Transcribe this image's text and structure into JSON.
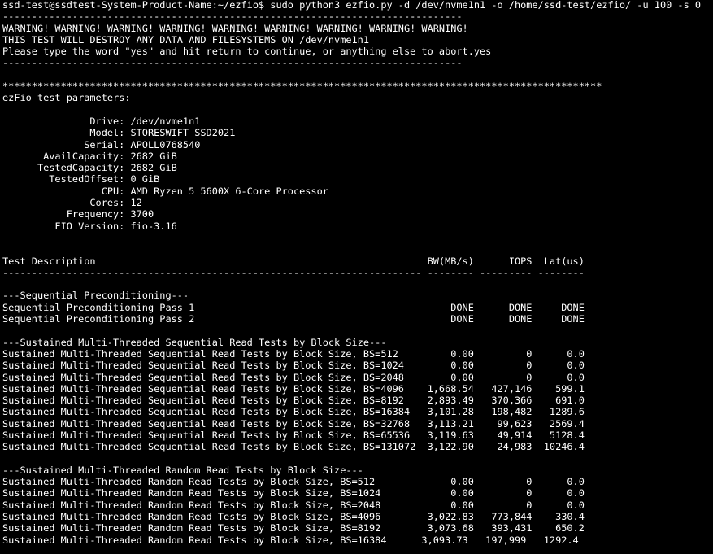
{
  "terminal": {
    "background": "#000000",
    "foreground": "#ffffff",
    "lines": [
      "ssd-test@ssdtest-System-Product-Name:~/ezfio$ sudo python3 ezfio.py -d /dev/nvme1n1 -o /home/ssd-test/ezfio/ -u 100 -s 0",
      "-------------------------------------------------------------------------------",
      "WARNING! WARNING! WARNING! WARNING! WARNING! WARNING! WARNING! WARNING! WARNING!",
      "THIS TEST WILL DESTROY ANY DATA AND FILESYSTEMS ON /dev/nvme1n1",
      "Please type the word \"yes\" and hit return to continue, or anything else to abort.yes",
      "-------------------------------------------------------------------------------",
      "",
      "*******************************************************************************************************",
      "ezFio test parameters:",
      "",
      "               Drive: /dev/nvme1n1",
      "               Model: STORESWIFT SSD2021",
      "              Serial: APOLL0768540",
      "       AvailCapacity: 2682 GiB",
      "      TestedCapacity: 2682 GiB",
      "        TestedOffset: 0 GiB",
      "                 CPU: AMD Ryzen 5 5600X 6-Core Processor",
      "               Cores: 12",
      "           Frequency: 3700",
      "         FIO Version: fio-3.16",
      "",
      "",
      "Test Description                                                         BW(MB/s)      IOPS  Lat(us)",
      "------------------------------------------------------------------------ -------- --------- --------",
      "",
      "---Sequential Preconditioning---",
      "Sequential Preconditioning Pass 1                                            DONE      DONE     DONE",
      "Sequential Preconditioning Pass 2                                            DONE      DONE     DONE",
      "",
      "---Sustained Multi-Threaded Sequential Read Tests by Block Size---",
      "Sustained Multi-Threaded Sequential Read Tests by Block Size, BS=512         0.00         0      0.0",
      "Sustained Multi-Threaded Sequential Read Tests by Block Size, BS=1024        0.00         0      0.0",
      "Sustained Multi-Threaded Sequential Read Tests by Block Size, BS=2048        0.00         0      0.0",
      "Sustained Multi-Threaded Sequential Read Tests by Block Size, BS=4096    1,668.54   427,146    599.1",
      "Sustained Multi-Threaded Sequential Read Tests by Block Size, BS=8192    2,893.49   370,366    691.0",
      "Sustained Multi-Threaded Sequential Read Tests by Block Size, BS=16384   3,101.28   198,482   1289.6",
      "Sustained Multi-Threaded Sequential Read Tests by Block Size, BS=32768   3,113.21    99,623   2569.4",
      "Sustained Multi-Threaded Sequential Read Tests by Block Size, BS=65536   3,119.63    49,914   5128.4",
      "Sustained Multi-Threaded Sequential Read Tests by Block Size, BS=131072  3,122.90    24,983  10246.4",
      "",
      "---Sustained Multi-Threaded Random Read Tests by Block Size---",
      "Sustained Multi-Threaded Random Read Tests by Block Size, BS=512             0.00         0      0.0",
      "Sustained Multi-Threaded Random Read Tests by Block Size, BS=1024            0.00         0      0.0",
      "Sustained Multi-Threaded Random Read Tests by Block Size, BS=2048            0.00         0      0.0",
      "Sustained Multi-Threaded Random Read Tests by Block Size, BS=4096        3,022.83   773,844    330.4",
      "Sustained Multi-Threaded Random Read Tests by Block Size, BS=8192        3,073.68   393,431    650.2",
      "Sustained Multi-Threaded Random Read Tests by Block Size, BS=16384      3,093.73   197,999   1292.4"
    ]
  }
}
